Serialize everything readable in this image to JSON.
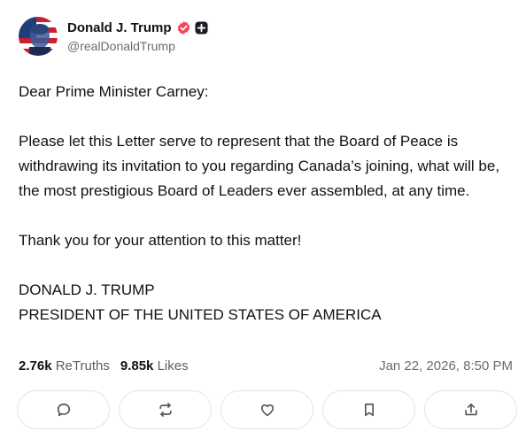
{
  "author": {
    "display_name": "Donald J. Trump",
    "handle": "@realDonaldTrump",
    "avatar_icon": "portrait-avatar",
    "verified_icon": "verified-badge-icon",
    "badge_icon": "plus-badge-icon"
  },
  "post": {
    "salutation": "Dear Prime Minister Carney:",
    "paragraph": "Please let this Letter serve to represent that the Board of Peace is withdrawing its invitation to you regarding Canada’s joining, what will be, the most prestigious Board of Leaders ever assembled, at any time.",
    "closing": "Thank you for your attention to this matter!",
    "signature_name": "DONALD J. TRUMP",
    "signature_title": "PRESIDENT OF THE UNITED STATES OF AMERICA"
  },
  "stats": {
    "retruths_count": "2.76k",
    "retruths_label": "ReTruths",
    "likes_count": "9.85k",
    "likes_label": "Likes",
    "timestamp": "Jan 22, 2026, 8:50 PM"
  },
  "actions": {
    "reply_icon": "comment-icon",
    "retruth_icon": "repost-icon",
    "like_icon": "heart-icon",
    "bookmark_icon": "bookmark-icon",
    "share_icon": "share-icon"
  },
  "colors": {
    "verified": "#f2465a",
    "text": "#111111",
    "muted": "#6b6b76",
    "border": "#e3e3e8"
  }
}
